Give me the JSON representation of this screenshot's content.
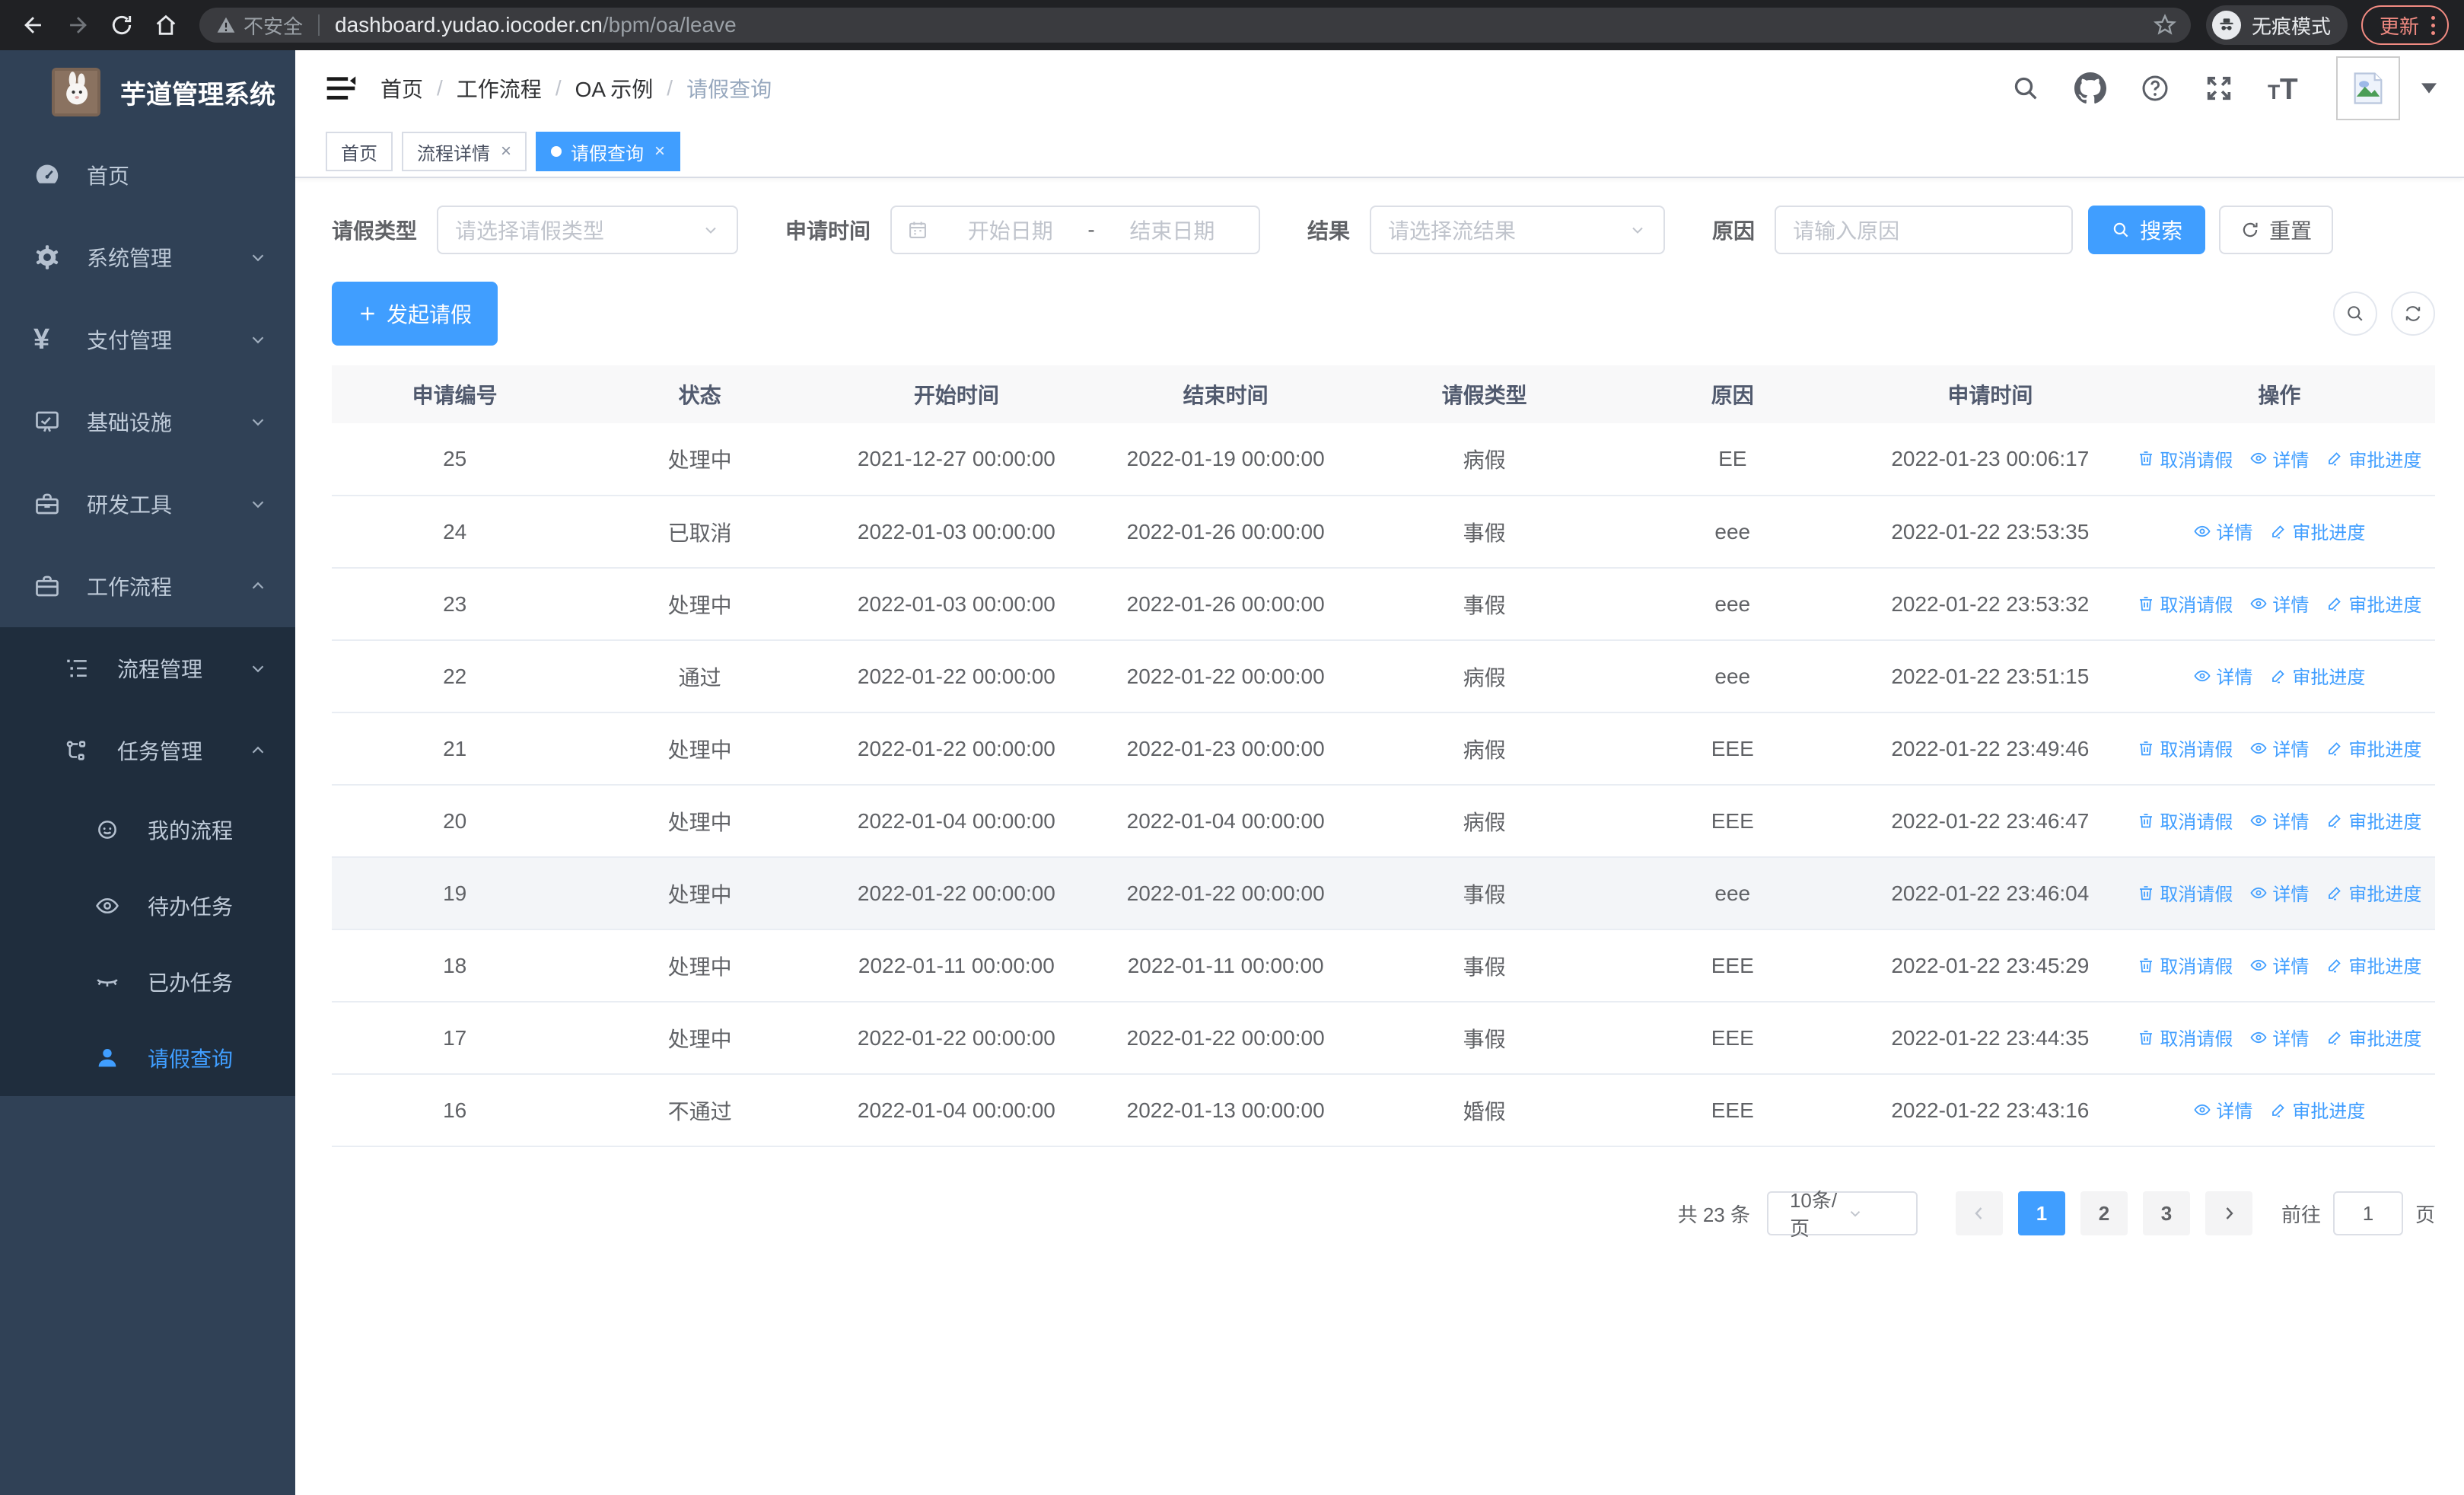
{
  "browser": {
    "security_label": "不安全",
    "url_host": "dashboard.yudao.iocoder.cn",
    "url_path": "/bpm/oa/leave",
    "incognito_label": "无痕模式",
    "update_label": "更新"
  },
  "sidebar": {
    "title": "芋道管理系统",
    "items": [
      {
        "label": "首页"
      },
      {
        "label": "系统管理"
      },
      {
        "label": "支付管理"
      },
      {
        "label": "基础设施"
      },
      {
        "label": "研发工具"
      },
      {
        "label": "工作流程"
      },
      {
        "label": "流程管理"
      },
      {
        "label": "任务管理"
      },
      {
        "label": "我的流程"
      },
      {
        "label": "待办任务"
      },
      {
        "label": "已办任务"
      },
      {
        "label": "请假查询"
      }
    ]
  },
  "breadcrumb": {
    "items": [
      "首页",
      "工作流程",
      "OA 示例",
      "请假查询"
    ]
  },
  "tabs": [
    {
      "label": "首页"
    },
    {
      "label": "流程详情"
    },
    {
      "label": "请假查询"
    }
  ],
  "filters": {
    "leave_type_label": "请假类型",
    "leave_type_placeholder": "请选择请假类型",
    "apply_time_label": "申请时间",
    "start_date_placeholder": "开始日期",
    "range_separator": "-",
    "end_date_placeholder": "结束日期",
    "result_label": "结果",
    "result_placeholder": "请选择流结果",
    "reason_label": "原因",
    "reason_placeholder": "请输入原因",
    "search_label": "搜索",
    "reset_label": "重置"
  },
  "toolbar": {
    "create_label": "发起请假"
  },
  "table": {
    "columns": [
      "申请编号",
      "状态",
      "开始时间",
      "结束时间",
      "请假类型",
      "原因",
      "申请时间",
      "操作"
    ],
    "action_labels": {
      "cancel": "取消请假",
      "detail": "详情",
      "progress": "审批进度"
    },
    "rows": [
      {
        "id": "25",
        "status": "处理中",
        "start": "2021-12-27 00:00:00",
        "end": "2022-01-19 00:00:00",
        "type": "病假",
        "reason": "EE",
        "applied": "2022-01-23 00:06:17",
        "actions": [
          "cancel",
          "detail",
          "progress"
        ],
        "highlighted": false
      },
      {
        "id": "24",
        "status": "已取消",
        "start": "2022-01-03 00:00:00",
        "end": "2022-01-26 00:00:00",
        "type": "事假",
        "reason": "eee",
        "applied": "2022-01-22 23:53:35",
        "actions": [
          "detail",
          "progress"
        ],
        "highlighted": false
      },
      {
        "id": "23",
        "status": "处理中",
        "start": "2022-01-03 00:00:00",
        "end": "2022-01-26 00:00:00",
        "type": "事假",
        "reason": "eee",
        "applied": "2022-01-22 23:53:32",
        "actions": [
          "cancel",
          "detail",
          "progress"
        ],
        "highlighted": false
      },
      {
        "id": "22",
        "status": "通过",
        "start": "2022-01-22 00:00:00",
        "end": "2022-01-22 00:00:00",
        "type": "病假",
        "reason": "eee",
        "applied": "2022-01-22 23:51:15",
        "actions": [
          "detail",
          "progress"
        ],
        "highlighted": false
      },
      {
        "id": "21",
        "status": "处理中",
        "start": "2022-01-22 00:00:00",
        "end": "2022-01-23 00:00:00",
        "type": "病假",
        "reason": "EEE",
        "applied": "2022-01-22 23:49:46",
        "actions": [
          "cancel",
          "detail",
          "progress"
        ],
        "highlighted": false
      },
      {
        "id": "20",
        "status": "处理中",
        "start": "2022-01-04 00:00:00",
        "end": "2022-01-04 00:00:00",
        "type": "病假",
        "reason": "EEE",
        "applied": "2022-01-22 23:46:47",
        "actions": [
          "cancel",
          "detail",
          "progress"
        ],
        "highlighted": false
      },
      {
        "id": "19",
        "status": "处理中",
        "start": "2022-01-22 00:00:00",
        "end": "2022-01-22 00:00:00",
        "type": "事假",
        "reason": "eee",
        "applied": "2022-01-22 23:46:04",
        "actions": [
          "cancel",
          "detail",
          "progress"
        ],
        "highlighted": true
      },
      {
        "id": "18",
        "status": "处理中",
        "start": "2022-01-11 00:00:00",
        "end": "2022-01-11 00:00:00",
        "type": "事假",
        "reason": "EEE",
        "applied": "2022-01-22 23:45:29",
        "actions": [
          "cancel",
          "detail",
          "progress"
        ],
        "highlighted": false
      },
      {
        "id": "17",
        "status": "处理中",
        "start": "2022-01-22 00:00:00",
        "end": "2022-01-22 00:00:00",
        "type": "事假",
        "reason": "EEE",
        "applied": "2022-01-22 23:44:35",
        "actions": [
          "cancel",
          "detail",
          "progress"
        ],
        "highlighted": false
      },
      {
        "id": "16",
        "status": "不通过",
        "start": "2022-01-04 00:00:00",
        "end": "2022-01-13 00:00:00",
        "type": "婚假",
        "reason": "EEE",
        "applied": "2022-01-22 23:43:16",
        "actions": [
          "detail",
          "progress"
        ],
        "highlighted": false
      }
    ]
  },
  "pagination": {
    "total_label": "共 23 条",
    "page_size_label": "10条/页",
    "pages": [
      "1",
      "2",
      "3"
    ],
    "active_page": "1",
    "goto_label": "前往",
    "goto_value": "1",
    "unit_label": "页"
  },
  "colors": {
    "primary": "#409EFF",
    "sidebar_bg": "#304156",
    "submenu_bg": "#1F2D3D",
    "update_accent": "#F28B82"
  }
}
